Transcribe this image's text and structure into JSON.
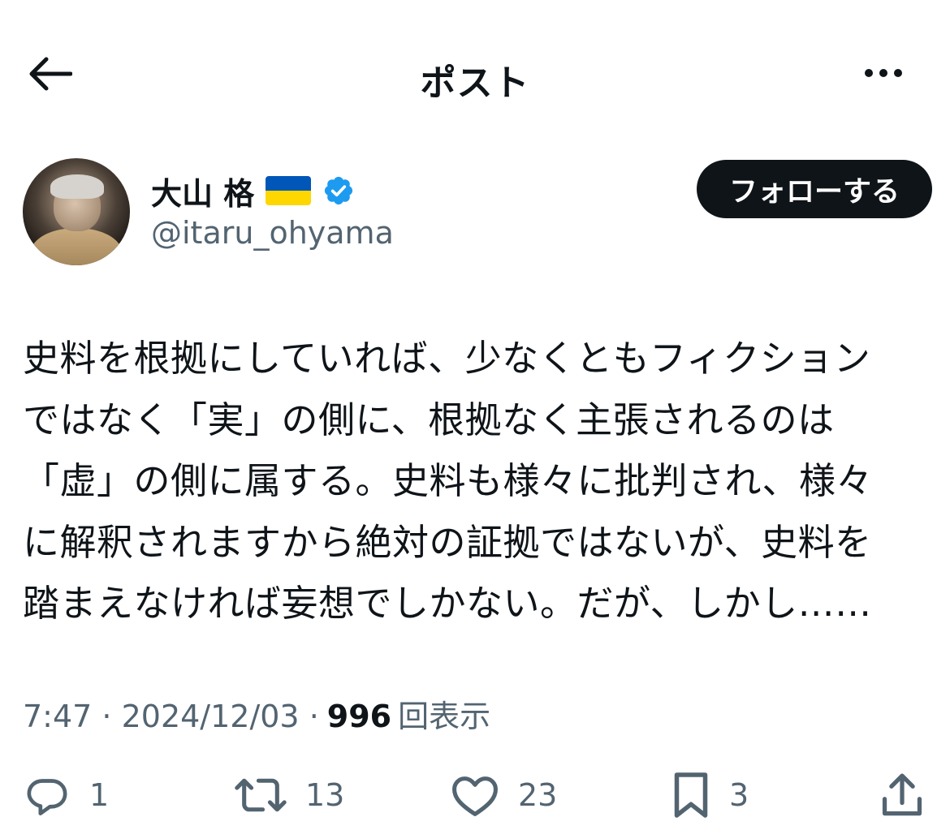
{
  "header": {
    "title": "ポスト"
  },
  "author": {
    "display_name": "大山 格",
    "handle": "@itaru_ohyama",
    "flag_colors": [
      "#0057b7",
      "#ffd700"
    ],
    "verified_color": "#1d9bf0",
    "follow_label": "フォローする"
  },
  "post": {
    "text": "史料を根拠にしていれば、少なくともフィクション\nではなく「実」の側に、根拠なく主張されるのは\n「虚」の側に属する。史料も様々に批判され、様々\nに解釈されますから絶対の証拠ではないが、史料を\n踏まえなければ妄想でしかない。だが、しかし……",
    "time": "7:47",
    "date": "2024/12/03",
    "views": "996",
    "views_label": "回表示"
  },
  "actions": {
    "replies": "1",
    "reposts": "13",
    "likes": "23",
    "bookmarks": "3"
  },
  "icons": [
    "back-arrow-icon",
    "more-icon",
    "flag-icon",
    "verified-icon",
    "reply-icon",
    "repost-icon",
    "like-icon",
    "bookmark-icon",
    "share-icon"
  ]
}
